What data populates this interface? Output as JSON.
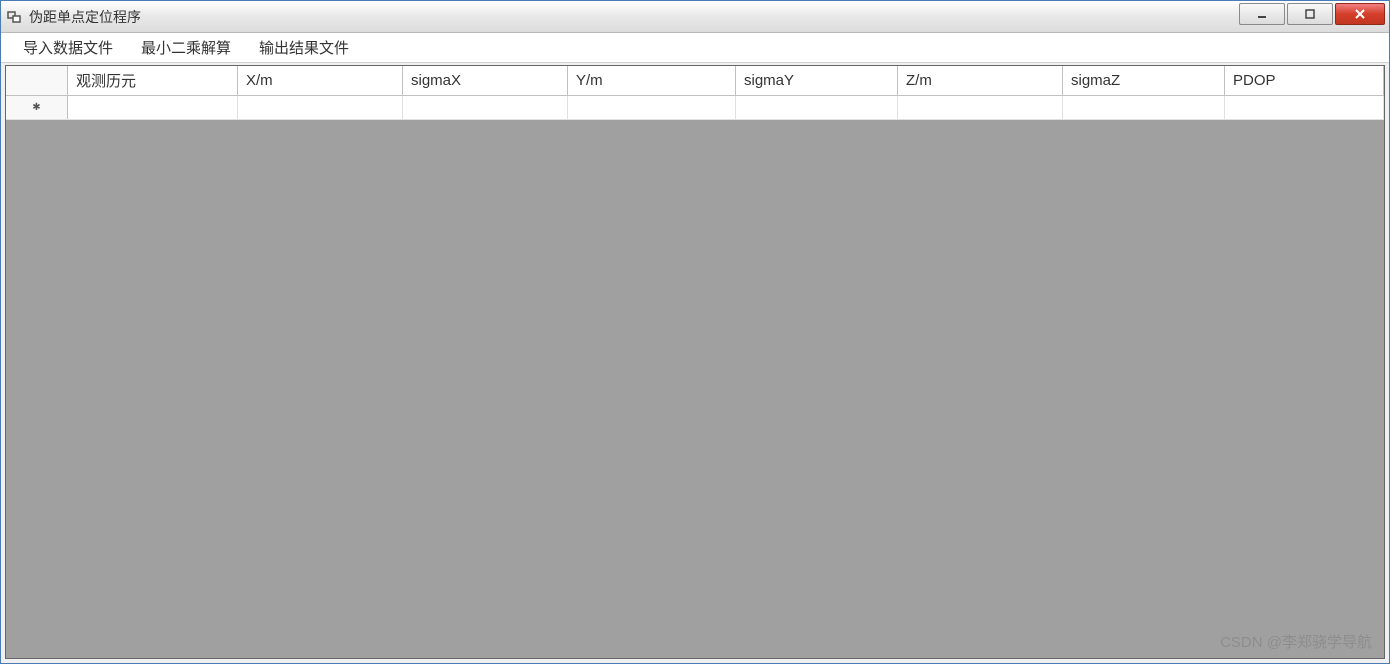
{
  "window": {
    "title": "伪距单点定位程序"
  },
  "menubar": {
    "items": [
      {
        "label": "导入数据文件"
      },
      {
        "label": "最小二乘解算"
      },
      {
        "label": "输出结果文件"
      }
    ]
  },
  "grid": {
    "columns": [
      {
        "header": ""
      },
      {
        "header": "观测历元"
      },
      {
        "header": "X/m"
      },
      {
        "header": "sigmaX"
      },
      {
        "header": "Y/m"
      },
      {
        "header": "sigmaY"
      },
      {
        "header": "Z/m"
      },
      {
        "header": "sigmaZ"
      },
      {
        "header": "PDOP"
      }
    ],
    "rows": [
      {
        "marker": "✱",
        "cells": [
          "",
          "",
          "",
          "",
          "",
          "",
          "",
          ""
        ]
      }
    ]
  },
  "watermark": "CSDN @李郑骁学导航"
}
